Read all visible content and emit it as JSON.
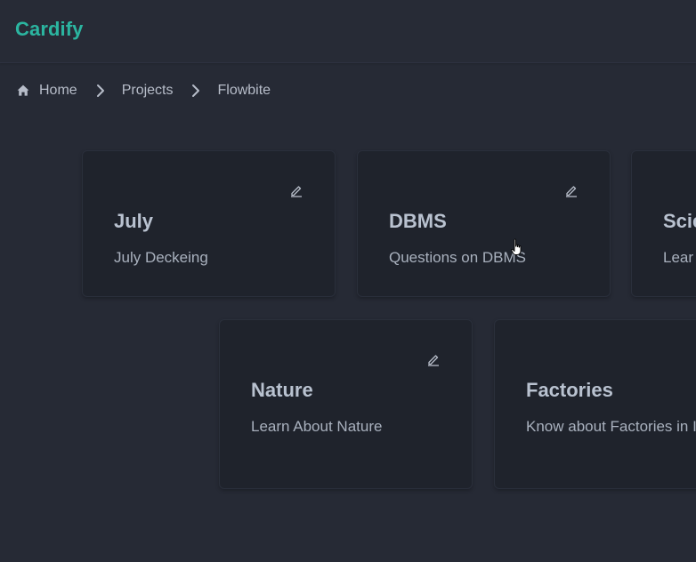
{
  "header": {
    "brand": "Cardify"
  },
  "breadcrumb": {
    "items": [
      "Home",
      "Projects",
      "Flowbite"
    ]
  },
  "cards": [
    {
      "title": "July",
      "description": "July Deckeing"
    },
    {
      "title": "DBMS",
      "description": "Questions on DBMS"
    },
    {
      "title": "Scie",
      "description": "Lear"
    },
    {
      "title": "Nature",
      "description": "Learn About Nature"
    },
    {
      "title": "Factories",
      "description": "Know about Factories in India"
    }
  ],
  "colors": {
    "brand": "#2bb5a0",
    "background": "#262a35",
    "card": "#1f232c"
  },
  "icons": [
    "home-icon",
    "chevron-right-icon",
    "edit-icon",
    "hand-pointer-icon"
  ]
}
